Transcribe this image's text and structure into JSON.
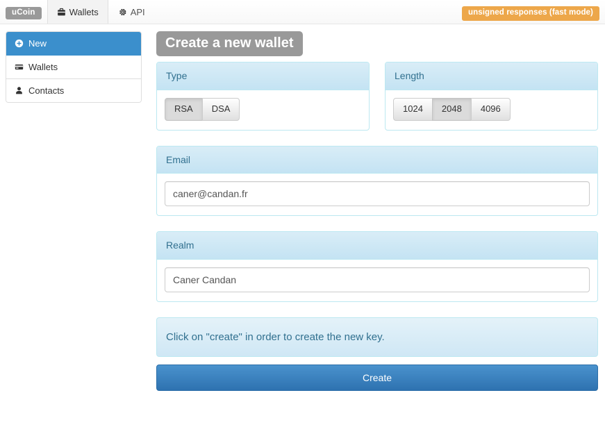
{
  "navbar": {
    "brand": "uCoin",
    "tabs": [
      {
        "label": "Wallets",
        "icon": "briefcase-icon",
        "active": true
      },
      {
        "label": "API",
        "icon": "gear-icon",
        "active": false
      }
    ],
    "status_badge": "unsigned responses (fast mode)",
    "status_badge_color": "#eda74a"
  },
  "sidebar": {
    "items": [
      {
        "label": "New",
        "icon": "plus-circle-icon",
        "active": true
      },
      {
        "label": "Wallets",
        "icon": "credit-card-icon",
        "active": false
      },
      {
        "label": "Contacts",
        "icon": "user-icon",
        "active": false
      }
    ],
    "active_color": "#3b8fcc"
  },
  "main": {
    "heading": "Create a new wallet",
    "heading_color": "#999999",
    "type_panel": {
      "title": "Type",
      "options": [
        "RSA",
        "DSA"
      ],
      "selected": "RSA"
    },
    "length_panel": {
      "title": "Length",
      "options": [
        "1024",
        "2048",
        "4096"
      ],
      "selected": "2048"
    },
    "email_panel": {
      "title": "Email",
      "value": "caner@candan.fr",
      "placeholder": "Email"
    },
    "realm_panel": {
      "title": "Realm",
      "value": "Caner Candan",
      "placeholder": "Realm"
    },
    "info_alert": "Click on \"create\" in order to create the new key.",
    "create_button": "Create",
    "create_button_color": "#3d82be"
  }
}
